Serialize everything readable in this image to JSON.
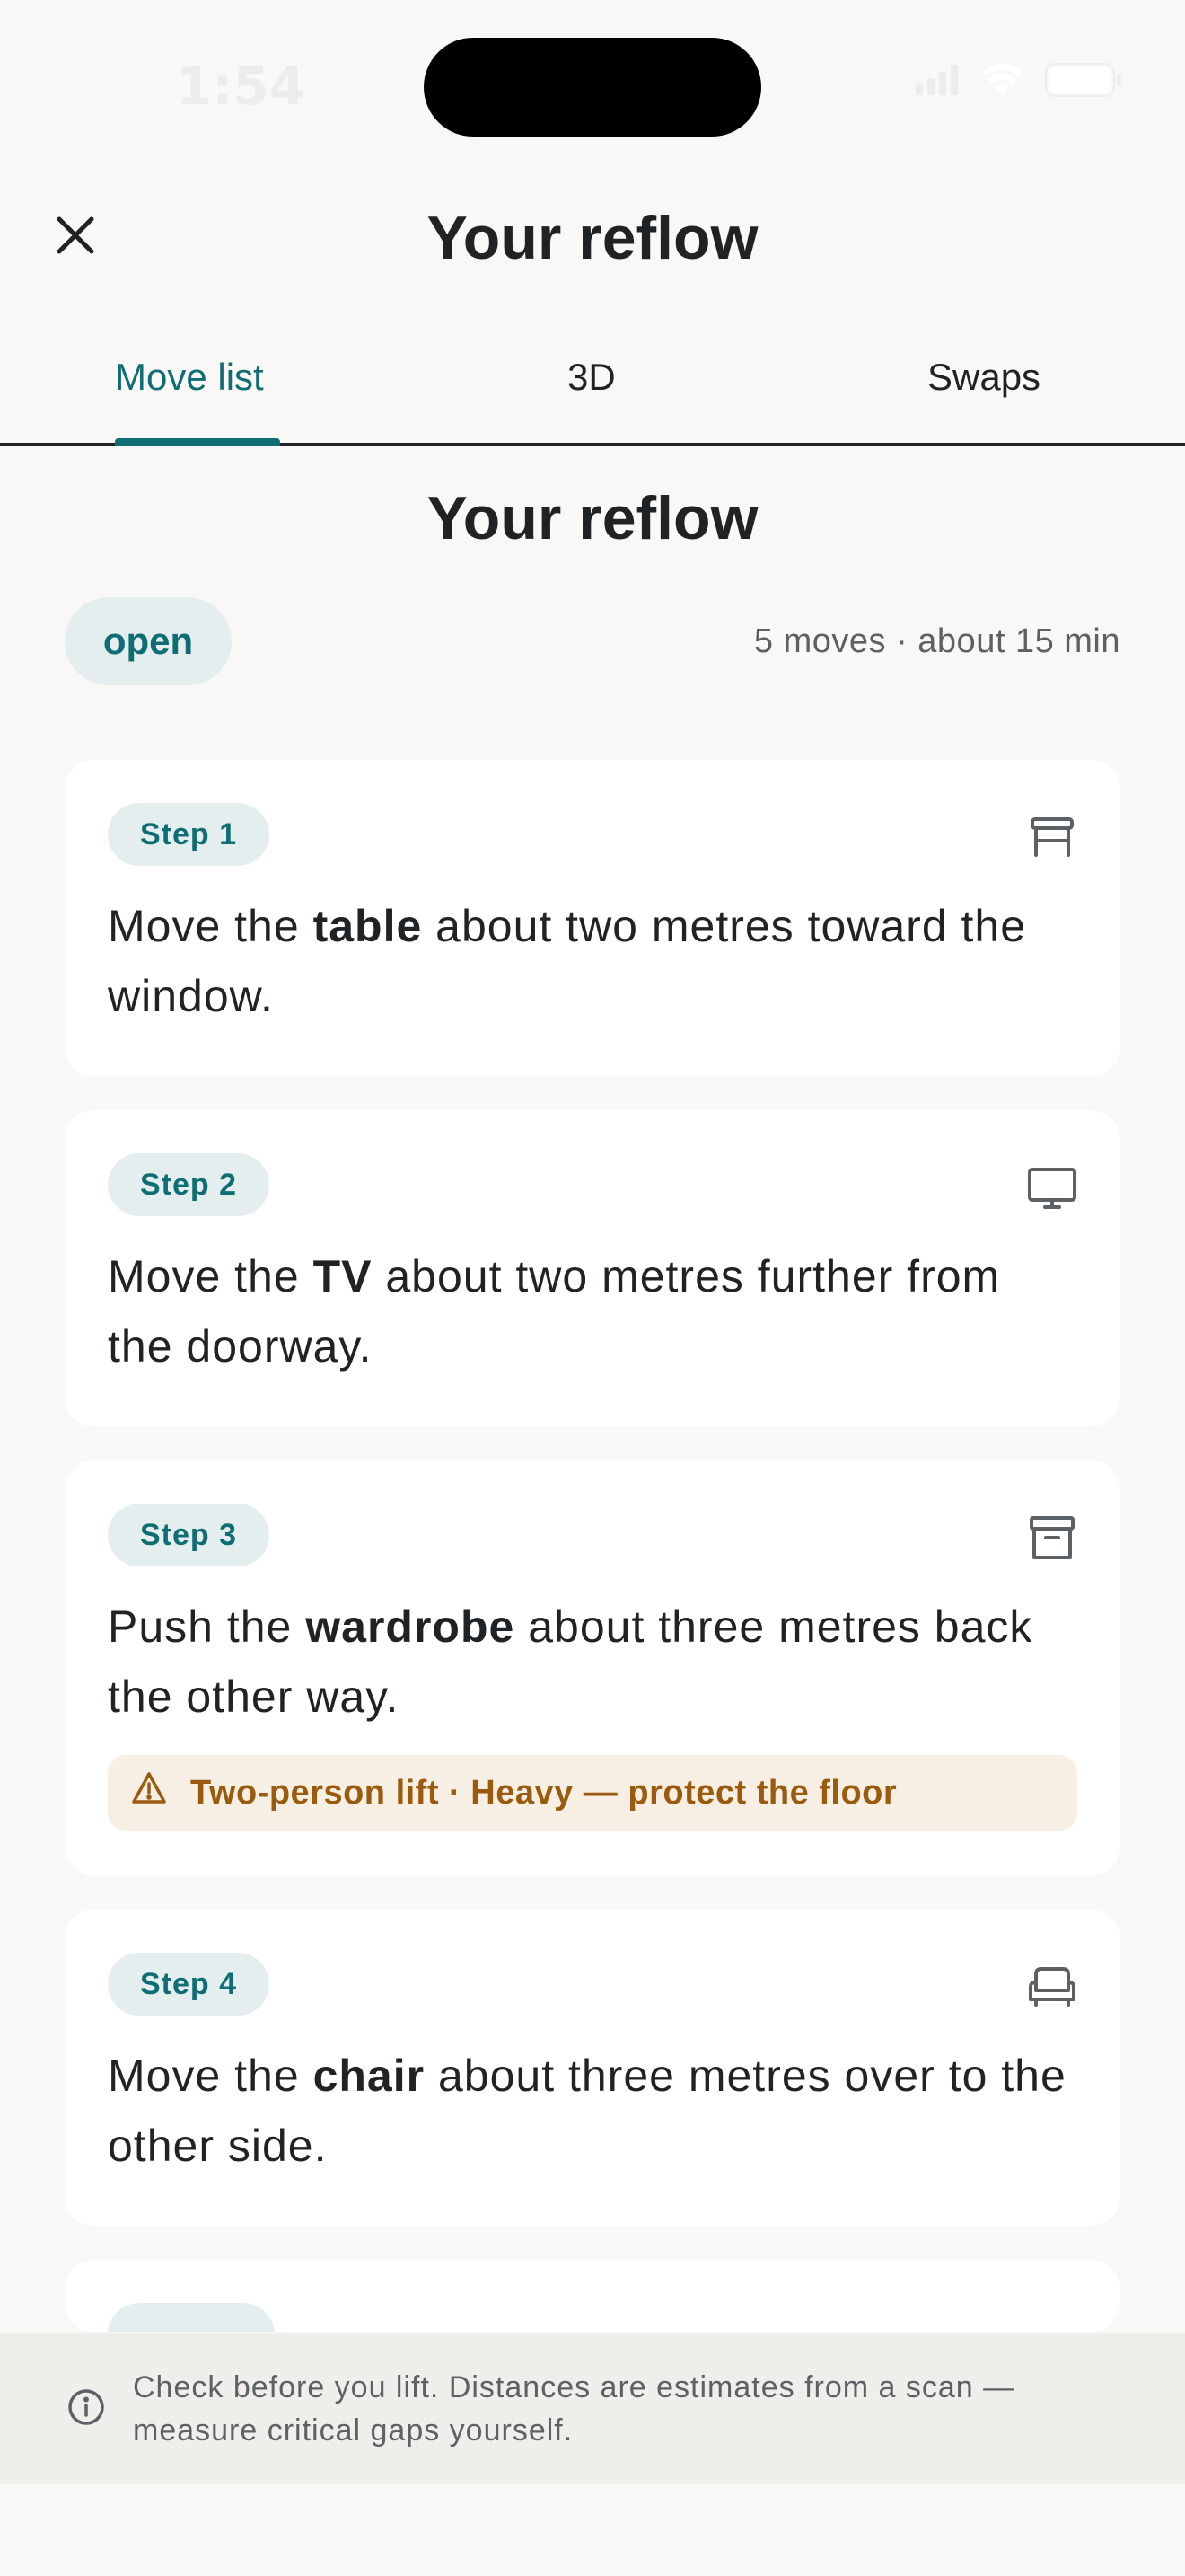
{
  "status_bar": {
    "time": "1:54"
  },
  "header": {
    "title": "Your reflow"
  },
  "tabs": [
    {
      "label": "Move list",
      "active": true
    },
    {
      "label": "3D",
      "active": false
    },
    {
      "label": "Swaps",
      "active": false
    }
  ],
  "summary": {
    "title": "Your reflow",
    "status": "open",
    "meta": "5 moves · about 15 min"
  },
  "steps": [
    {
      "badge": "Step 1",
      "icon": "table-icon",
      "pre": "Move the ",
      "item": "table",
      "post": " about two metres toward the window."
    },
    {
      "badge": "Step 2",
      "icon": "tv-icon",
      "pre": "Move the ",
      "item": "TV",
      "post": " about two metres further from the doorway."
    },
    {
      "badge": "Step 3",
      "icon": "archive-box-icon",
      "pre": "Push the ",
      "item": "wardrobe",
      "post": " about three metres back the other way.",
      "warning": "Two-person lift · Heavy — protect the floor"
    },
    {
      "badge": "Step 4",
      "icon": "armchair-icon",
      "pre": "Move the ",
      "item": "chair",
      "post": " about three metres over to the other side."
    }
  ],
  "disclaimer": {
    "icon": "info-icon",
    "text": "Check before you lift. Distances are estimates from a scan — measure critical gaps yourself."
  },
  "colors": {
    "accent": "#0f6e74",
    "warning": "#9a5b0e",
    "background": "#f9f8f6"
  }
}
